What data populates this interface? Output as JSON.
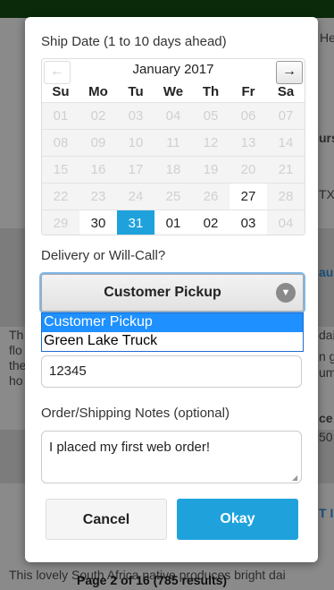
{
  "background": {
    "lines": [
      {
        "text": "He",
        "cls": ""
      },
      {
        "text": "urs",
        "cls": "bg-strong"
      },
      {
        "text": "TX",
        "cls": ""
      },
      {
        "text": "au",
        "cls": "bg-link"
      },
      {
        "text": "Th",
        "cls": ""
      },
      {
        "text": "flo",
        "cls": ""
      },
      {
        "text": "the",
        "cls": ""
      },
      {
        "text": "ho",
        "cls": ""
      },
      {
        "text": "dai",
        "cls": ""
      },
      {
        "text": "n g",
        "cls": ""
      },
      {
        "text": "um",
        "cls": ""
      },
      {
        "text": "ce",
        "cls": "bg-strong"
      },
      {
        "text": "50",
        "cls": ""
      },
      {
        "text": "T I",
        "cls": "bg-link"
      }
    ],
    "footer_text": "This lovely South Africa native produces bright dai",
    "pagination": "Page 2 of 16 (785 results)"
  },
  "modal": {
    "ship_date_label": "Ship Date (1 to 10 days ahead)",
    "calendar": {
      "prev": "←",
      "next": "→",
      "month_title": "January 2017",
      "weekdays": [
        "Su",
        "Mo",
        "Tu",
        "We",
        "Th",
        "Fr",
        "Sa"
      ],
      "weeks": [
        [
          {
            "d": "01",
            "s": "off"
          },
          {
            "d": "02",
            "s": "off"
          },
          {
            "d": "03",
            "s": "off"
          },
          {
            "d": "04",
            "s": "off"
          },
          {
            "d": "05",
            "s": "off"
          },
          {
            "d": "06",
            "s": "off"
          },
          {
            "d": "07",
            "s": "off"
          }
        ],
        [
          {
            "d": "08",
            "s": "off"
          },
          {
            "d": "09",
            "s": "off"
          },
          {
            "d": "10",
            "s": "off"
          },
          {
            "d": "11",
            "s": "off"
          },
          {
            "d": "12",
            "s": "off"
          },
          {
            "d": "13",
            "s": "off"
          },
          {
            "d": "14",
            "s": "off"
          }
        ],
        [
          {
            "d": "15",
            "s": "off"
          },
          {
            "d": "16",
            "s": "off"
          },
          {
            "d": "17",
            "s": "off"
          },
          {
            "d": "18",
            "s": "off"
          },
          {
            "d": "19",
            "s": "off"
          },
          {
            "d": "20",
            "s": "off"
          },
          {
            "d": "21",
            "s": "off"
          }
        ],
        [
          {
            "d": "22",
            "s": "off"
          },
          {
            "d": "23",
            "s": "off"
          },
          {
            "d": "24",
            "s": "off"
          },
          {
            "d": "25",
            "s": "off"
          },
          {
            "d": "26",
            "s": "off"
          },
          {
            "d": "27",
            "s": "active"
          },
          {
            "d": "28",
            "s": "off"
          }
        ],
        [
          {
            "d": "29",
            "s": "off"
          },
          {
            "d": "30",
            "s": "active"
          },
          {
            "d": "31",
            "s": "selected"
          },
          {
            "d": "01",
            "s": "active"
          },
          {
            "d": "02",
            "s": "active"
          },
          {
            "d": "03",
            "s": "active"
          },
          {
            "d": "04",
            "s": "off"
          }
        ]
      ]
    },
    "delivery_label": "Delivery or Will-Call?",
    "delivery_select": {
      "value": "Customer Pickup",
      "options": [
        "Customer Pickup",
        "Green Lake Truck"
      ],
      "highlighted_index": 0
    },
    "zip_value": "12345",
    "notes_label": "Order/Shipping Notes (optional)",
    "notes_value": "I placed my first web order!",
    "cancel_label": "Cancel",
    "okay_label": "Okay",
    "colors": {
      "accent": "#1fa2dc",
      "highlight": "#1e90ff"
    }
  }
}
